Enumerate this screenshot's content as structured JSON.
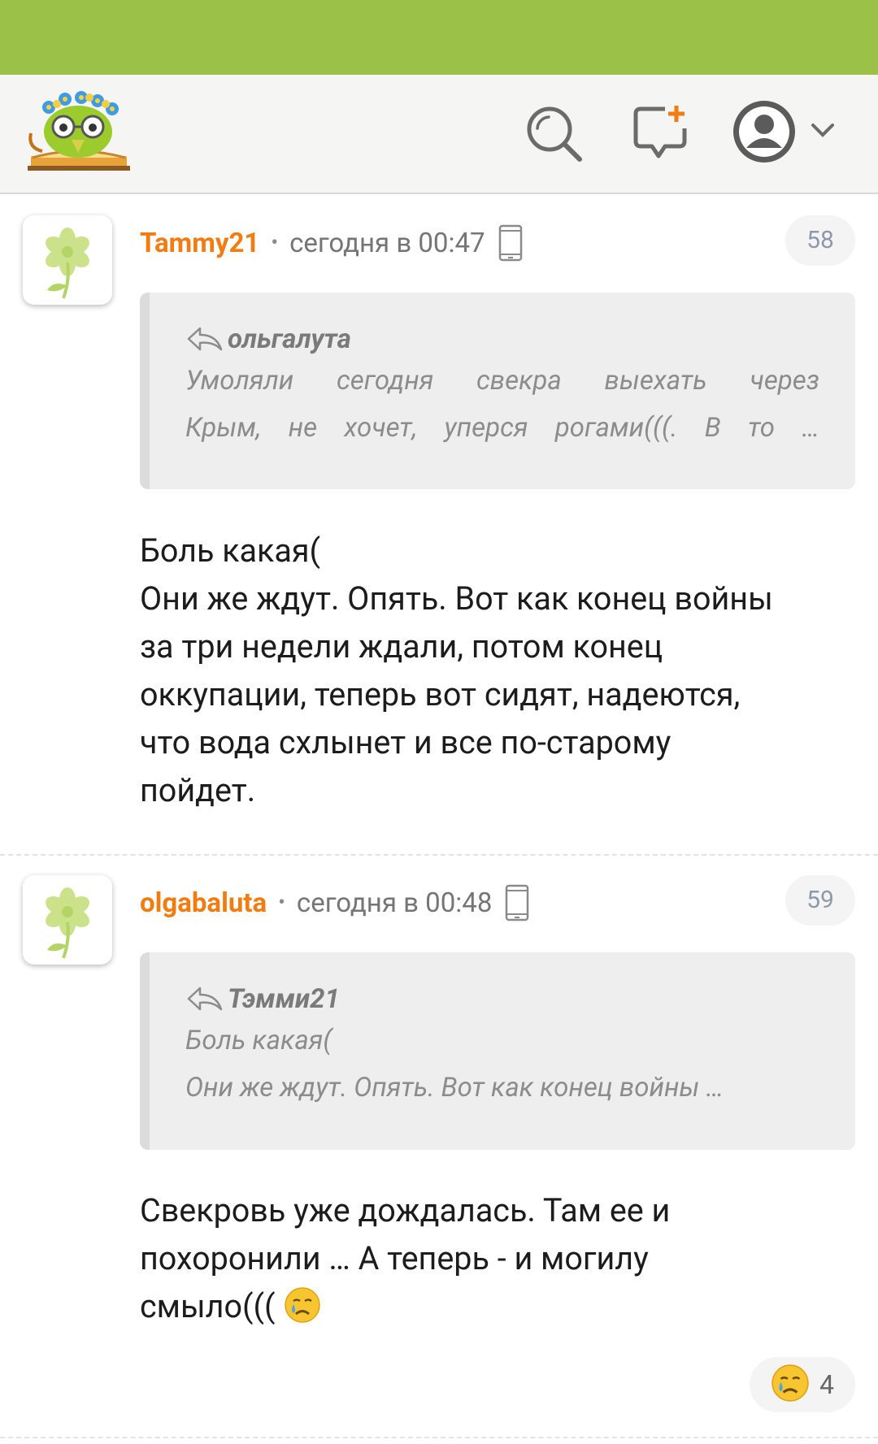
{
  "comments": [
    {
      "author": "Tammy21",
      "separator": "•",
      "time": "сегодня в 00:47",
      "number": "58",
      "quote": {
        "author": "ольгалута",
        "lines": [
          "Умоляли сегодня свекра выехать через",
          "Крым, не хочет, уперся рогами(((. В то …"
        ]
      },
      "body": [
        "Боль какая(",
        "Они же ждут. Опять. Вот как конец войны",
        "за три недели ждали, потом конец",
        "оккупации, теперь вот сидят, надеются,",
        "что вода схлынет и все по-старому",
        "пойдет."
      ]
    },
    {
      "author": "olgabaluta",
      "separator": "•",
      "time": "сегодня в 00:48",
      "number": "59",
      "quote": {
        "author": "Тэмми21",
        "lines": [
          "Боль какая(",
          "Они же ждут. Опять. Вот как конец войны …"
        ]
      },
      "body": [
        "Свекровь уже дождалась. Там ее и",
        "похоронили … А теперь - и могилу",
        "смыло((("
      ],
      "reaction": {
        "emoji": "crying-face",
        "count": "4"
      }
    }
  ],
  "colors": {
    "status_bar": "#9bc148",
    "header_bg": "#f5f5f3",
    "author": "#f07c12",
    "quote_bg": "#eeeeee"
  },
  "icons": [
    "site-logo",
    "search-icon",
    "new-post-icon",
    "profile-avatar-icon",
    "chevron-down-icon",
    "flower-avatar-icon",
    "phone-icon",
    "reply-icon",
    "crying-face-icon"
  ]
}
